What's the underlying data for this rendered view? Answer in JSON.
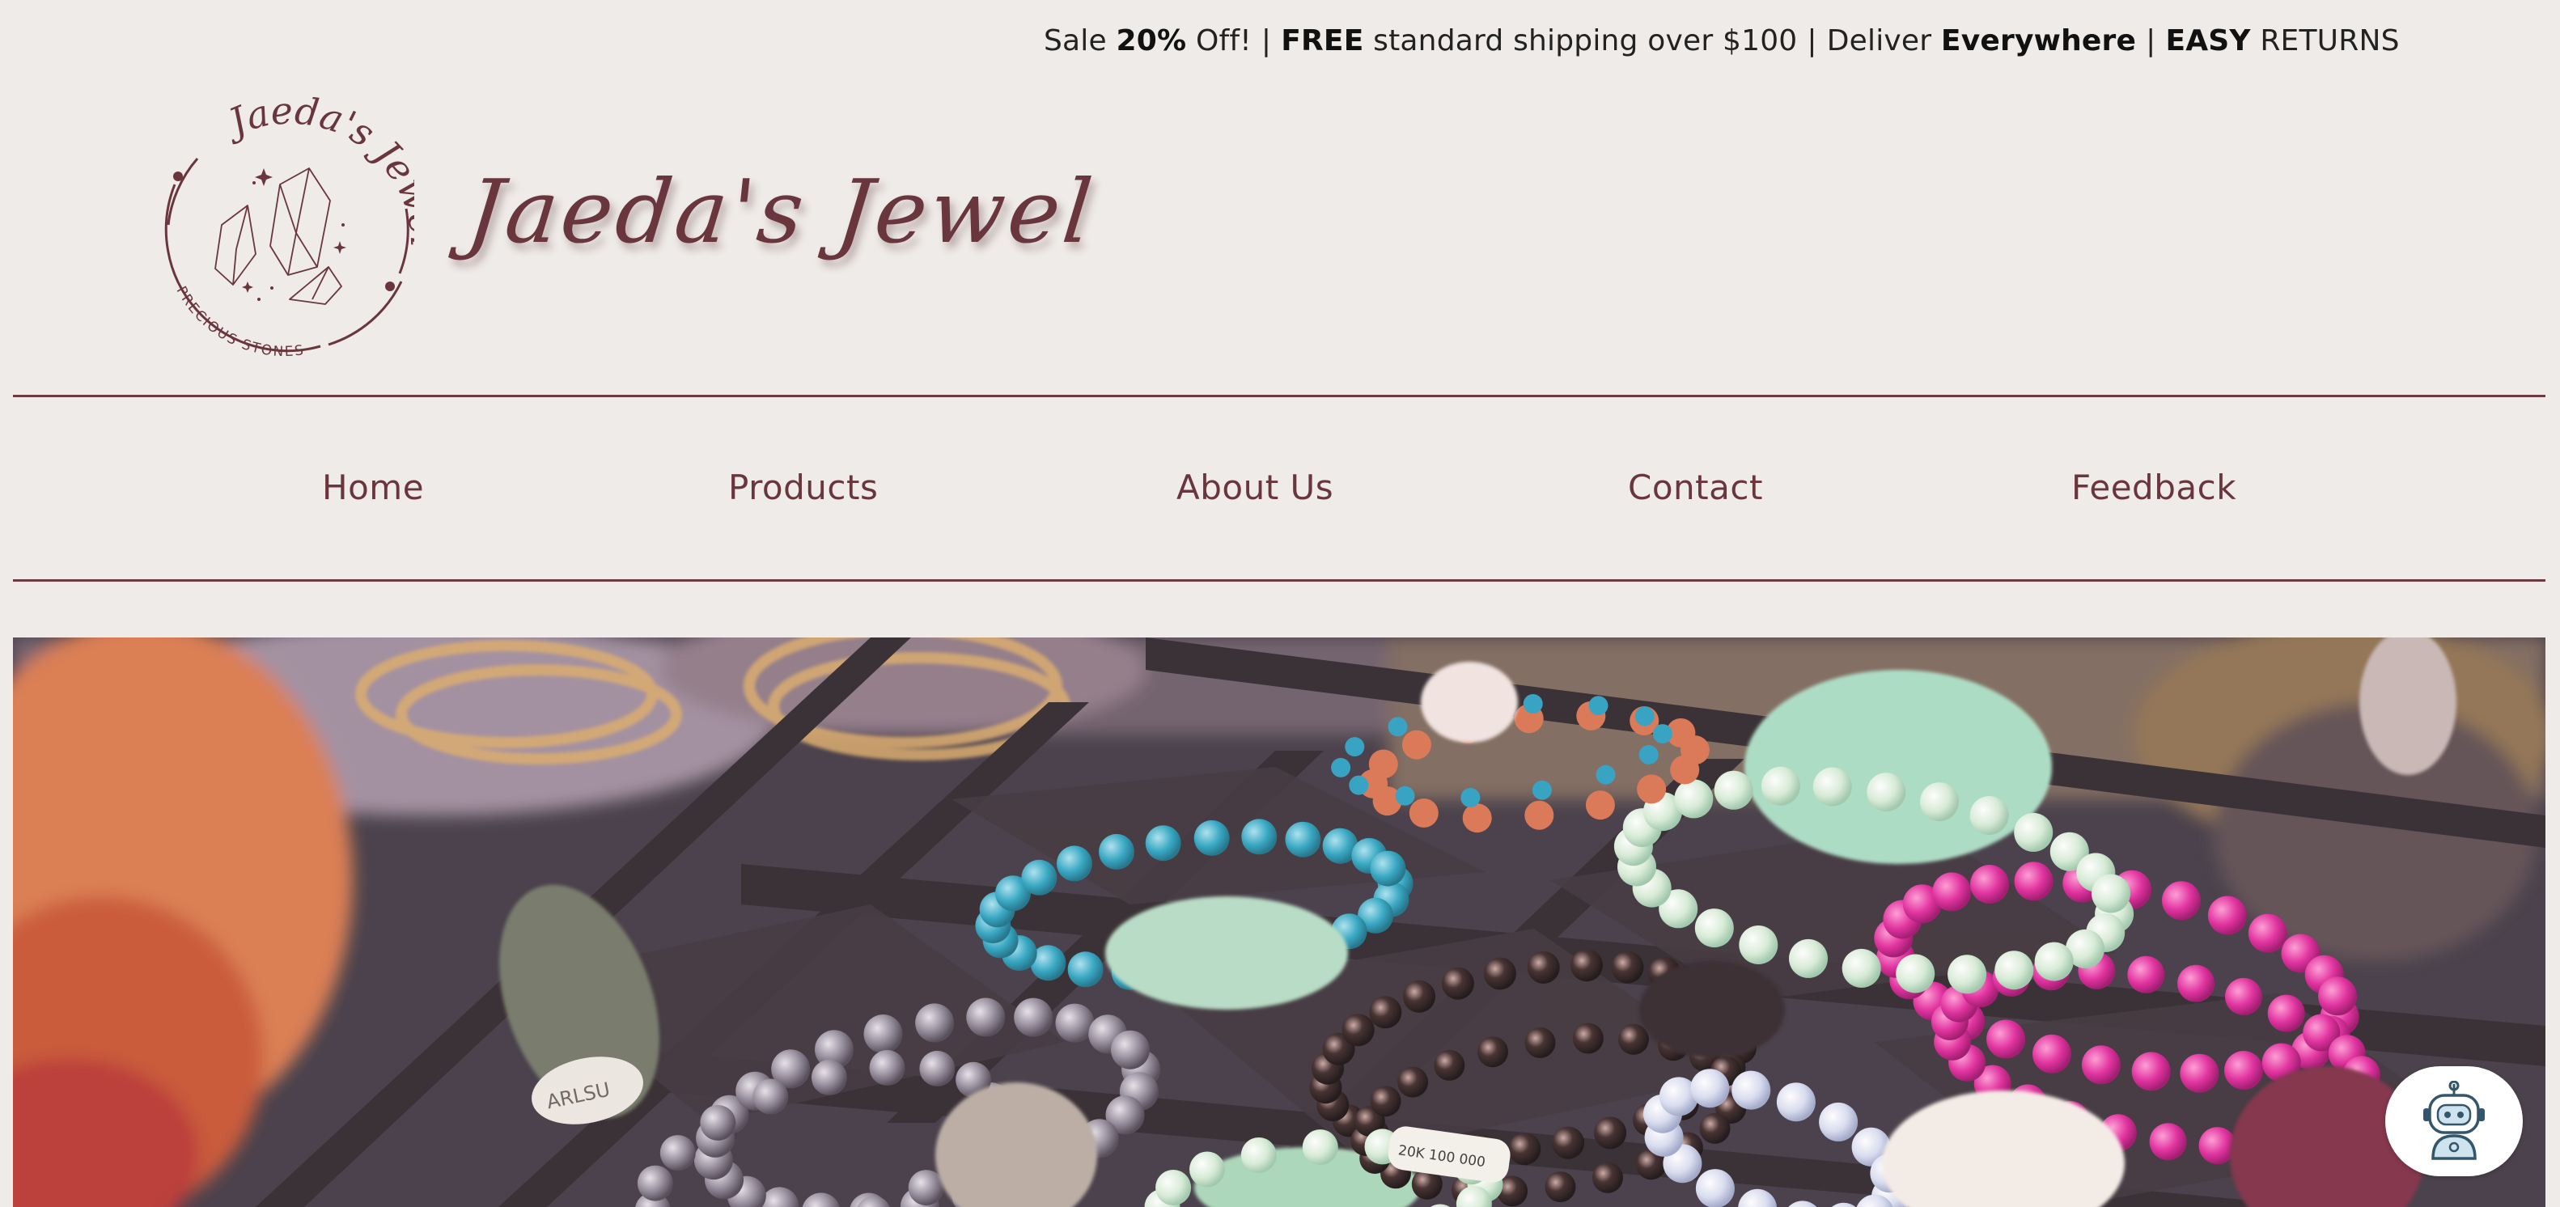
{
  "promo": {
    "part1_pre": "Sale ",
    "part1_bold": "20%",
    "part1_post": " Off!",
    "sep": "|",
    "part2_bold": "FREE",
    "part2_post": " standard shipping over $100",
    "part3_pre": "Deliver ",
    "part3_bold": "Everywhere",
    "part4_bold": "EASY",
    "part4_post": " RETURNS"
  },
  "brand": {
    "title": "Jaeda's Jewel",
    "emblem_arc_text": "Jaeda's Jewel",
    "emblem_bottom_text": "PRECIOUS STONES"
  },
  "nav": {
    "items": [
      {
        "label": "Home"
      },
      {
        "label": "Products"
      },
      {
        "label": "About Us"
      },
      {
        "label": "Contact"
      },
      {
        "label": "Feedback"
      }
    ]
  },
  "hero": {
    "price_tag_1": "ARLSU",
    "price_tag_2": "20K 100 000"
  },
  "colors": {
    "background": "#efebe8",
    "brand": "#6a363d",
    "rule": "#6e3a42",
    "text": "#222222"
  },
  "icons": {
    "chatbot": "robot-icon",
    "logo": "crystal-emblem-icon"
  }
}
